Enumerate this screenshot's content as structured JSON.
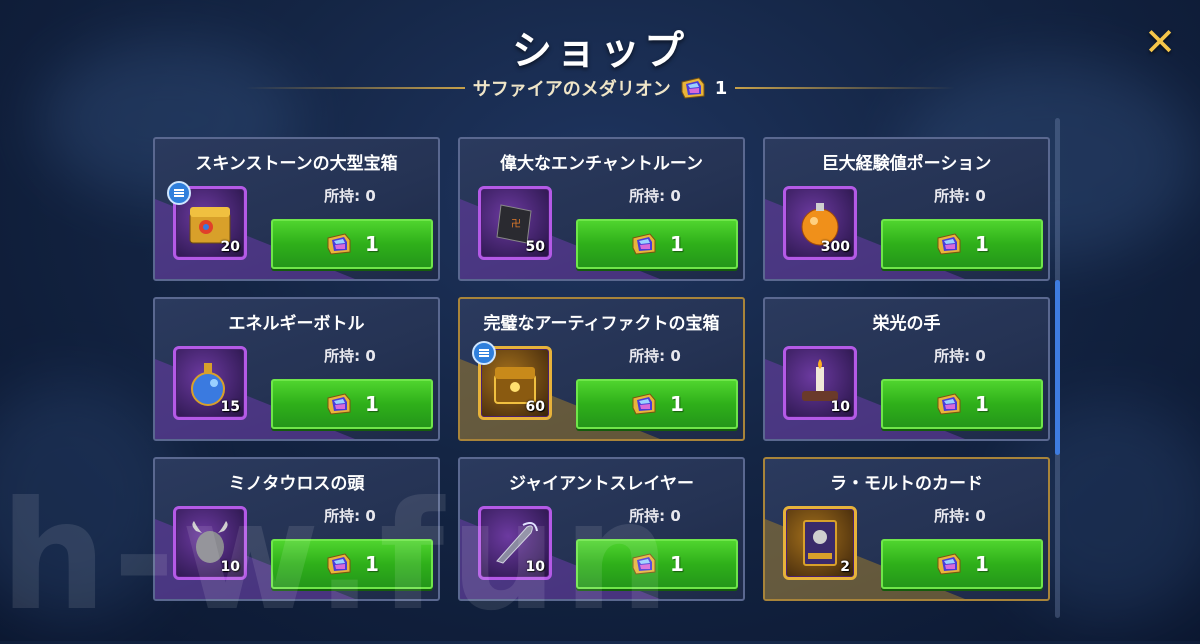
{
  "title": "ショップ",
  "currency": {
    "name": "サファイアのメダリオン",
    "count": "1",
    "icon": "sapphire-medallion-icon"
  },
  "owned_label": "所持:",
  "items": [
    {
      "name": "スキンストーンの大型宝箱",
      "owned": "0",
      "qty": "20",
      "price": "1",
      "frame": "purple",
      "info": true,
      "icon": "skin-stone-chest-icon"
    },
    {
      "name": "偉大なエンチャントルーン",
      "owned": "0",
      "qty": "50",
      "price": "1",
      "frame": "purple",
      "info": false,
      "icon": "enchant-rune-icon"
    },
    {
      "name": "巨大経験値ポーション",
      "owned": "0",
      "qty": "300",
      "price": "1",
      "frame": "purple",
      "info": false,
      "icon": "exp-potion-icon"
    },
    {
      "name": "エネルギーボトル",
      "owned": "0",
      "qty": "15",
      "price": "1",
      "frame": "purple",
      "info": false,
      "icon": "energy-bottle-icon"
    },
    {
      "name": "完璧なアーティファクトの宝箱",
      "owned": "0",
      "qty": "60",
      "price": "1",
      "frame": "gold",
      "info": true,
      "icon": "artifact-chest-icon"
    },
    {
      "name": "栄光の手",
      "owned": "0",
      "qty": "10",
      "price": "1",
      "frame": "purple",
      "info": false,
      "icon": "hand-of-glory-icon"
    },
    {
      "name": "ミノタウロスの頭",
      "owned": "0",
      "qty": "10",
      "price": "1",
      "frame": "purple",
      "info": false,
      "icon": "minotaur-head-icon"
    },
    {
      "name": "ジャイアントスレイヤー",
      "owned": "0",
      "qty": "10",
      "price": "1",
      "frame": "purple",
      "info": false,
      "icon": "giant-slayer-icon"
    },
    {
      "name": "ラ・モルトのカード",
      "owned": "0",
      "qty": "2",
      "price": "1",
      "frame": "gold",
      "info": false,
      "icon": "la-morte-card-icon"
    }
  ],
  "watermark": "h-w.fun",
  "colors": {
    "button_green": "#2fb01a",
    "gold": "#e7b23a",
    "purple": "#b45ae6",
    "background": "#142544"
  }
}
